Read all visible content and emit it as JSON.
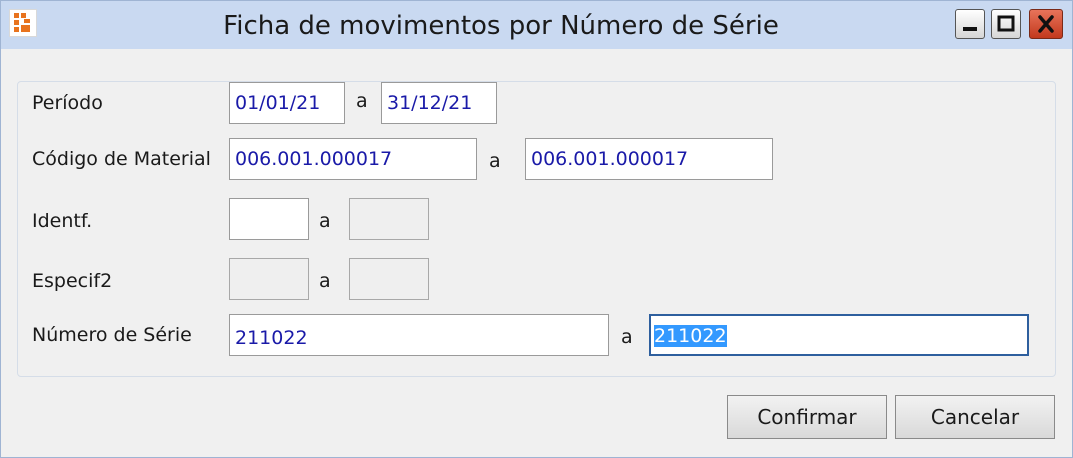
{
  "window": {
    "title": "Ficha de movimentos por Número de Série"
  },
  "form": {
    "periodo": {
      "label": "Período",
      "from": "01/01/21",
      "sep": "a",
      "to": "31/12/21"
    },
    "codigo_material": {
      "label": "Código de Material",
      "from": "006.001.000017",
      "sep": "a",
      "to": "006.001.000017"
    },
    "identf": {
      "label": "Identf.",
      "from": "",
      "sep": "a",
      "to": ""
    },
    "especif2": {
      "label": "Especif2",
      "from": "",
      "sep": "a",
      "to": ""
    },
    "numero_serie": {
      "label": "Número de Série",
      "from": "211022",
      "sep": "a",
      "to": "211022"
    }
  },
  "buttons": {
    "confirm_label": "Confirmar",
    "cancel_label": "Cancelar"
  },
  "colors": {
    "titlebar": "#c9d9f1",
    "field_text": "#1a1aa8",
    "selection": "#3399ff",
    "close_button": "#c2391d"
  },
  "icons": [
    "app-icon",
    "minimize-icon",
    "maximize-icon",
    "close-icon"
  ]
}
